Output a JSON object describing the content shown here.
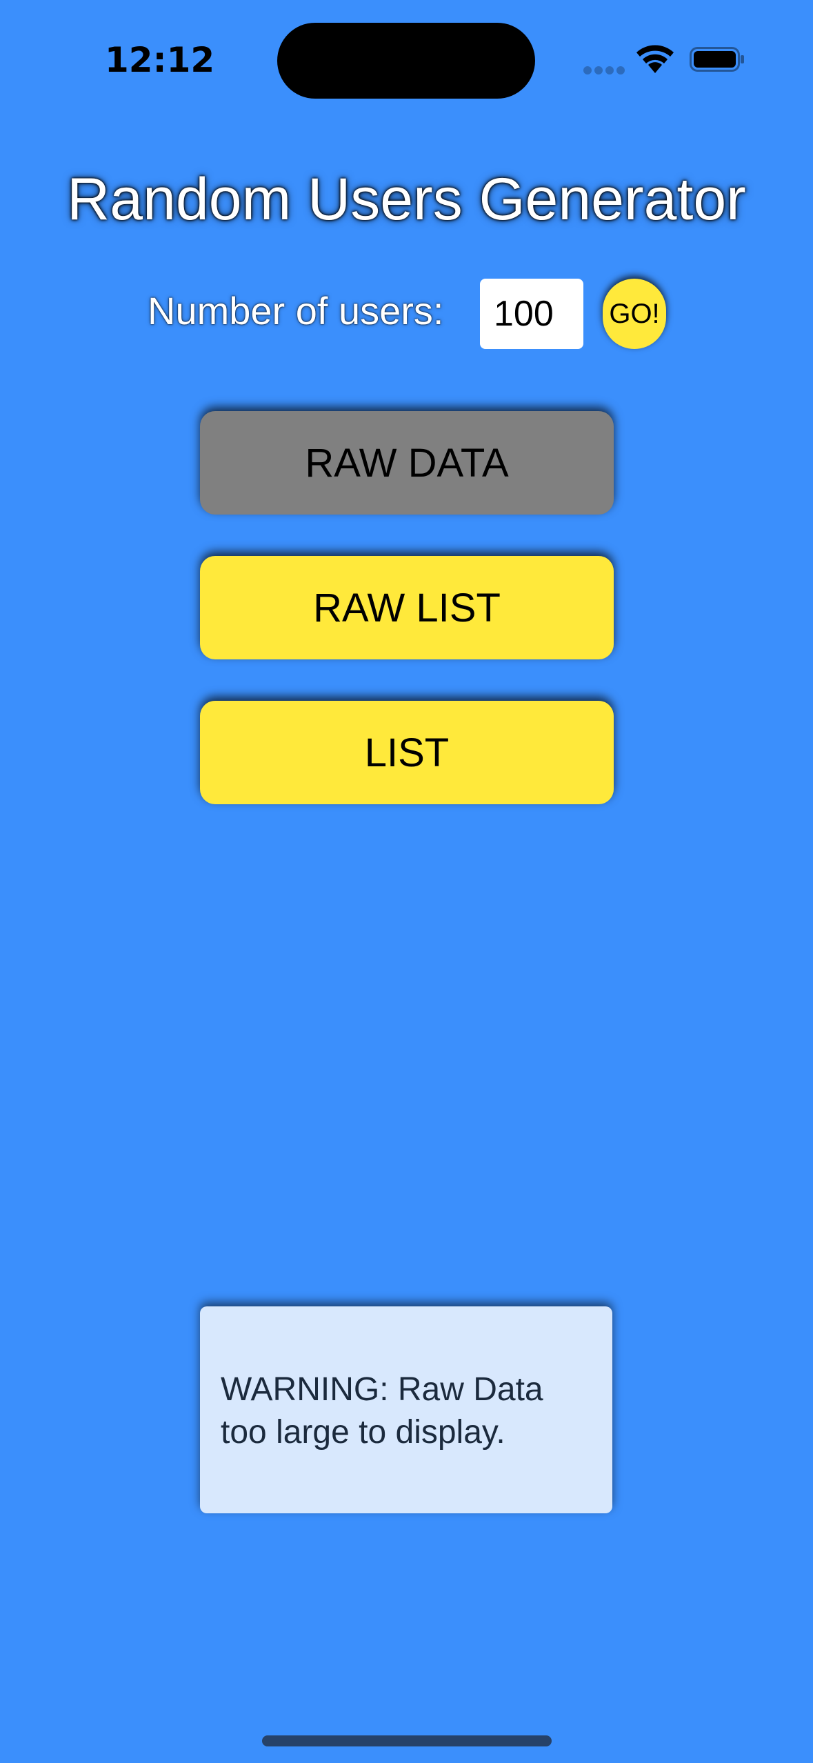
{
  "status_bar": {
    "time": "12:12"
  },
  "app": {
    "title": "Random Users Generator"
  },
  "controls": {
    "number_label": "Number of users:",
    "number_value": "100",
    "go_label": "GO!"
  },
  "buttons": {
    "raw_data": "RAW DATA",
    "raw_list": "RAW LIST",
    "list": "LIST"
  },
  "warning": {
    "text": "WARNING: Raw Data too large to display."
  },
  "colors": {
    "background": "#3b8ffc",
    "accent_yellow": "#ffe93b",
    "selected_gray": "#808080",
    "warning_bg": "#d8e8fd"
  },
  "icons": {
    "signal": "cellular-signal-icon",
    "wifi": "wifi-icon",
    "battery": "battery-icon"
  }
}
